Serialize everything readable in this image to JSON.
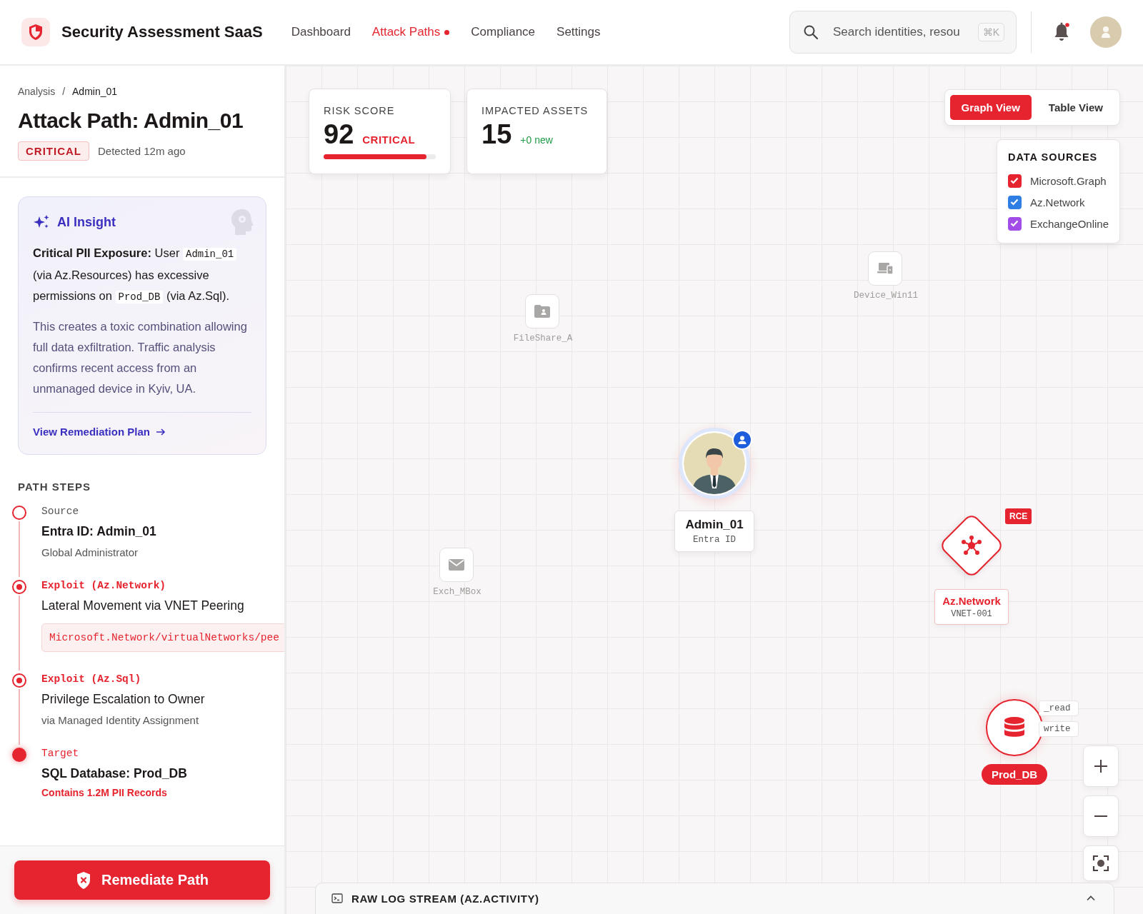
{
  "header": {
    "brand": "Security Assessment SaaS",
    "nav": [
      {
        "label": "Dashboard",
        "selected": false,
        "alert": false
      },
      {
        "label": "Attack Paths",
        "selected": true,
        "alert": true
      },
      {
        "label": "Compliance",
        "selected": false,
        "alert": false
      },
      {
        "label": "Settings",
        "selected": false,
        "alert": false
      }
    ],
    "search": {
      "placeholder": "Search identities, resou",
      "shortcut": "⌘K"
    },
    "notifications": {
      "unread": true
    }
  },
  "sidebar": {
    "breadcrumb": [
      "Analysis",
      "/",
      "Admin_01"
    ],
    "title": "Attack Path: Admin_01",
    "severity": "CRITICAL",
    "detected": "Detected 12m ago",
    "insight": {
      "title": "AI Insight",
      "summary": "**Critical PII Exposure:** User",
      "user_code": "Admin_01",
      "middle": "(via Az.Resources) has excessive permissions on",
      "resource_code": "Prod_DB",
      "tail": "(via Az.Sql).",
      "detail": "This creates a toxic combination allowing full data exfiltration. Traffic analysis confirms recent access from an unmanaged device in Kyiv, UA.",
      "link": "View Remediation Plan"
    },
    "steps_title": "PATH STEPS",
    "steps": [
      {
        "kind": "source",
        "label": "Source",
        "title": "Entra ID: Admin_01",
        "subtitle": "Global Administrator"
      },
      {
        "kind": "exploit",
        "label": "Exploit (Az.Network)",
        "title": "Lateral Movement via VNET Peering",
        "code": "Microsoft.Network/virtualNetworks/pee"
      },
      {
        "kind": "exploit",
        "label": "Exploit (Az.Sql)",
        "title": "Privilege Escalation to Owner",
        "subtitle": "via Managed Identity Assignment"
      },
      {
        "kind": "target",
        "label": "Target",
        "title": "SQL Database: Prod_DB",
        "note": "Contains 1.2M PII Records"
      }
    ],
    "action": "Remediate Path"
  },
  "canvas": {
    "stats": [
      {
        "label": "RISK SCORE",
        "value": "92",
        "tag": "CRITICAL",
        "level": 0.92
      },
      {
        "label": "IMPACTED ASSETS",
        "value": "15",
        "tag": "+0 new"
      }
    ],
    "views": [
      {
        "label": "Graph View",
        "selected": true
      },
      {
        "label": "Table View",
        "selected": false
      }
    ],
    "data_sources": {
      "title": "DATA SOURCES",
      "items": [
        {
          "label": "Microsoft.Graph",
          "checked": true,
          "color": "#e5242f"
        },
        {
          "label": "Az.Network",
          "checked": true,
          "color": "#2f7ee6"
        },
        {
          "label": "ExchangeOnline",
          "checked": true,
          "color": "#a24de8"
        }
      ]
    },
    "nodes": [
      {
        "kind": "folder",
        "label": "FileShare_A"
      },
      {
        "kind": "device",
        "label": "Device_Win11"
      },
      {
        "kind": "mail",
        "label": "Exch_MBox"
      },
      {
        "kind": "identity",
        "label": "Admin_01",
        "sub": "Entra ID"
      },
      {
        "kind": "network",
        "label": "Az.Network",
        "sub": "VNET-001",
        "badge": "RCE"
      },
      {
        "kind": "database",
        "label": "Prod_DB",
        "edges": [
          "_read",
          "write"
        ]
      }
    ],
    "log_stream": {
      "title": "RAW LOG STREAM (AZ.ACTIVITY)",
      "expanded": false
    }
  }
}
